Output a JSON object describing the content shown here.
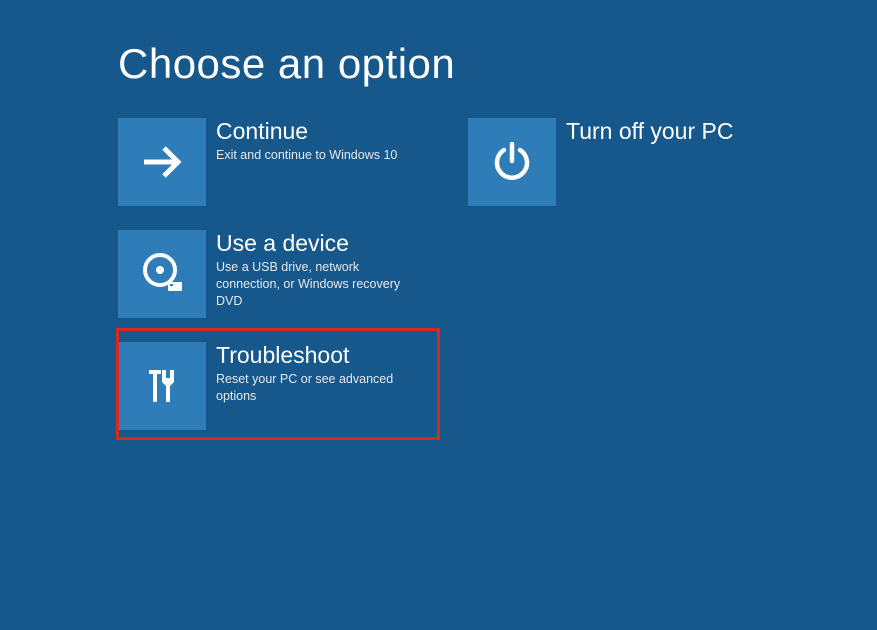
{
  "title": "Choose an option",
  "tiles": {
    "continue": {
      "title": "Continue",
      "desc": "Exit and continue to Windows 10"
    },
    "useDevice": {
      "title": "Use a device",
      "desc": "Use a USB drive, network connection, or Windows recovery DVD"
    },
    "troubleshoot": {
      "title": "Troubleshoot",
      "desc": "Reset your PC or see advanced options"
    },
    "turnOff": {
      "title": "Turn off your PC",
      "desc": ""
    }
  },
  "colors": {
    "background": "#16588c",
    "tile": "#2e7cb8",
    "highlight": "#d9281f"
  }
}
